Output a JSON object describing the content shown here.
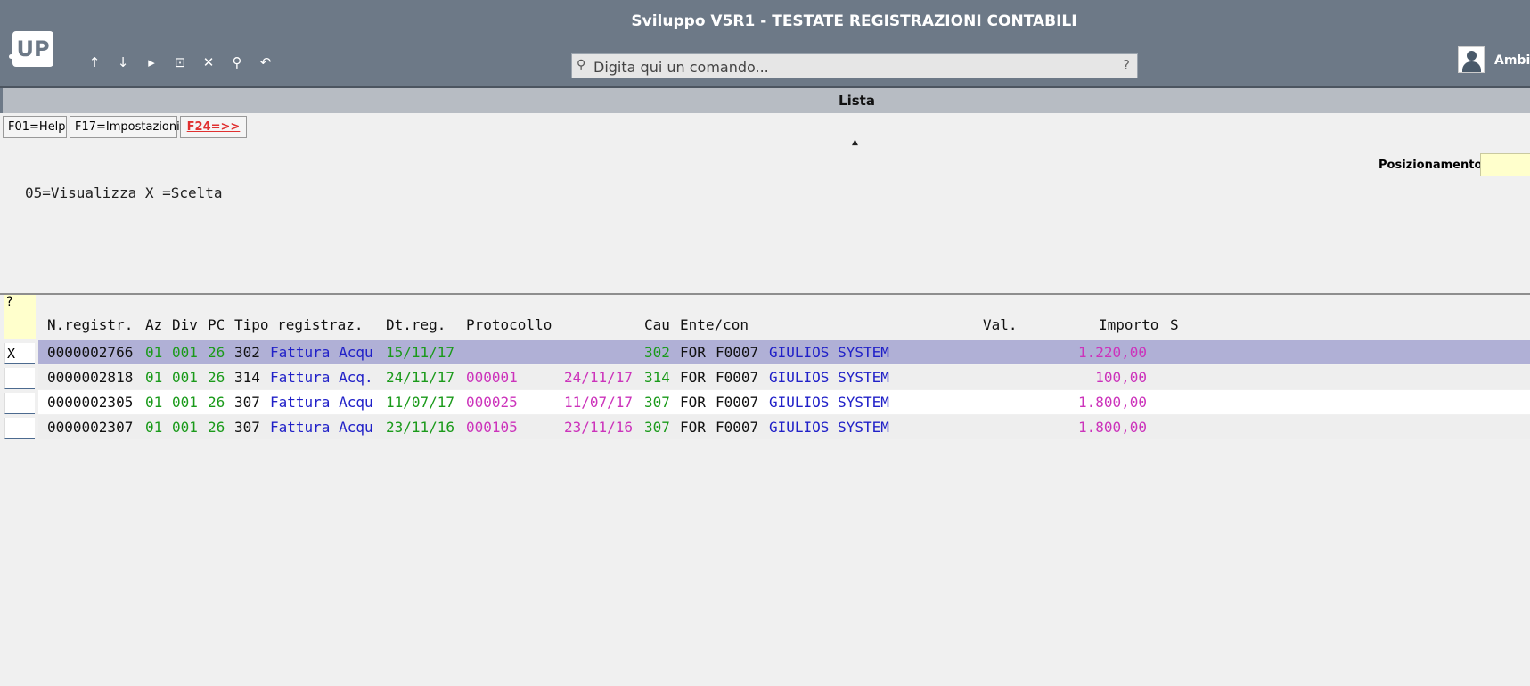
{
  "window": {
    "title": "Sviluppo V5R1 - TESTATE REGISTRAZIONI CONTABILI",
    "logo": "UP",
    "user": "Ambie"
  },
  "toolbar": {
    "icons": [
      "arrow-up-icon",
      "arrow-down-icon",
      "play-icon",
      "terminal-icon",
      "close-icon",
      "search-icon",
      "undo-icon"
    ],
    "glyphs": [
      "↑",
      "↓",
      "▸",
      "⊡",
      "✕",
      "⚲",
      "↶"
    ]
  },
  "command": {
    "placeholder": "Digita qui un comando...",
    "help": "?"
  },
  "panel": {
    "title": "Lista",
    "fkeys": [
      "F01=Help",
      "F17=Impostazioni",
      "F24=>>"
    ],
    "caret": "▲",
    "positioning_label": "Posizionamento:",
    "legend": "05=Visualizza X =Scelta",
    "question": "?"
  },
  "table": {
    "headers": {
      "nreg": "N.registr.",
      "az": "Az",
      "div": "Div",
      "pc": "PC",
      "tipo": "Tipo registraz.",
      "dtreg": "Dt.reg.",
      "prot": "Protocollo",
      "cau": "Cau",
      "ente": "Ente/con",
      "val": "Val.",
      "importo": "Importo",
      "s": "S"
    },
    "rows": [
      {
        "sel": "X",
        "nreg": "0000002766",
        "az": "01",
        "div": "001",
        "pc": "26",
        "tipo_code": "302",
        "tipo_desc": "Fattura Acqu",
        "dtreg": "15/11/17",
        "prot": "",
        "prot_date": "",
        "cau": "302",
        "ente_type": "FOR",
        "ente_code": "F0007",
        "ente_name": "GIULIOS SYSTEM",
        "importo": "1.220,00"
      },
      {
        "sel": "",
        "nreg": "0000002818",
        "az": "01",
        "div": "001",
        "pc": "26",
        "tipo_code": "314",
        "tipo_desc": "Fattura Acq.",
        "dtreg": "24/11/17",
        "prot": "000001",
        "prot_date": "24/11/17",
        "cau": "314",
        "ente_type": "FOR",
        "ente_code": "F0007",
        "ente_name": "GIULIOS SYSTEM",
        "importo": "100,00"
      },
      {
        "sel": "",
        "nreg": "0000002305",
        "az": "01",
        "div": "001",
        "pc": "26",
        "tipo_code": "307",
        "tipo_desc": "Fattura Acqu",
        "dtreg": "11/07/17",
        "prot": "000025",
        "prot_date": "11/07/17",
        "cau": "307",
        "ente_type": "FOR",
        "ente_code": "F0007",
        "ente_name": "GIULIOS SYSTEM",
        "importo": "1.800,00"
      },
      {
        "sel": "",
        "nreg": "0000002307",
        "az": "01",
        "div": "001",
        "pc": "26",
        "tipo_code": "307",
        "tipo_desc": "Fattura Acqu",
        "dtreg": "23/11/16",
        "prot": "000105",
        "prot_date": "23/11/16",
        "cau": "307",
        "ente_type": "FOR",
        "ente_code": "F0007",
        "ente_name": "GIULIOS SYSTEM",
        "importo": "1.800,00"
      }
    ]
  },
  "colors": {
    "titlebar": "#6d7987",
    "selected_row": "#b0b0d6",
    "green": "#1a9a1a",
    "blue": "#2020c8",
    "pink": "#cc33bb",
    "fkey_red": "#e03030"
  }
}
